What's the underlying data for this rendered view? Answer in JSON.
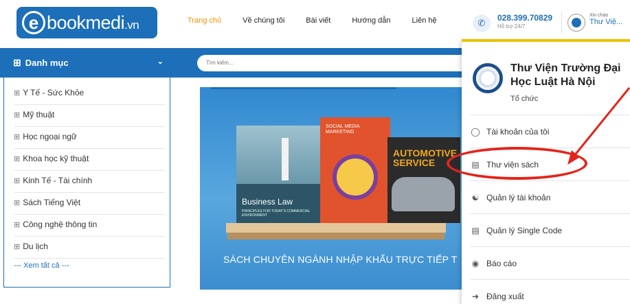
{
  "header": {
    "logo_e": "e",
    "logo_main": "bookmedi",
    "logo_suffix": ".vn",
    "nav": [
      "Trang chủ",
      "Về chúng tôi",
      "Bài viết",
      "Hướng dẫn",
      "Liên hệ"
    ],
    "phone": "028.399.70829",
    "phone_sub": "Hỗ trợ 24/7",
    "greeting": "Xin chào",
    "user_name": "Thư Việ..."
  },
  "categories": {
    "title": "Danh mục",
    "items": [
      "Y Tế - Sức Khỏe",
      "Mỹ thuật",
      "Học ngoại ngữ",
      "Khoa học kỹ thuật",
      "Kinh Tế - Tài chính",
      "Sách Tiếng Việt",
      "Công nghệ thông tin",
      "Du lịch"
    ],
    "more": "--- Xem tất cả ---"
  },
  "search": {
    "placeholder": "Tìm kiếm..."
  },
  "banner": {
    "book1_title": "Business Law",
    "book1_subtitle": "PRINCIPLES FOR TODAY'S COMMERCIAL ENVIRONMENT",
    "book2_title": "SOCIAL MEDIA MARKETING",
    "book3_title": "AUTOMOTIVE SERVICE",
    "caption": "SÁCH CHUYÊN NGÀNH NHẬP KHẨU TRỰC TIẾP T"
  },
  "account_menu": {
    "org_name": "Thư Viện Trường Đại Học Luật Hà Nội",
    "org_type": "Tổ chức",
    "items": [
      "Tài khoản của tôi",
      "Thư viện sách",
      "Quản lý tài khoản",
      "Quản lý Single Code",
      "Báo cáo",
      "Đăng xuất"
    ],
    "highlighted": "Thư viện sách"
  },
  "colors": {
    "brand_blue": "#1c6fb8",
    "nav_active": "#f39200",
    "annotation_red": "#e3241b",
    "panel_accent": "#e8c400"
  }
}
